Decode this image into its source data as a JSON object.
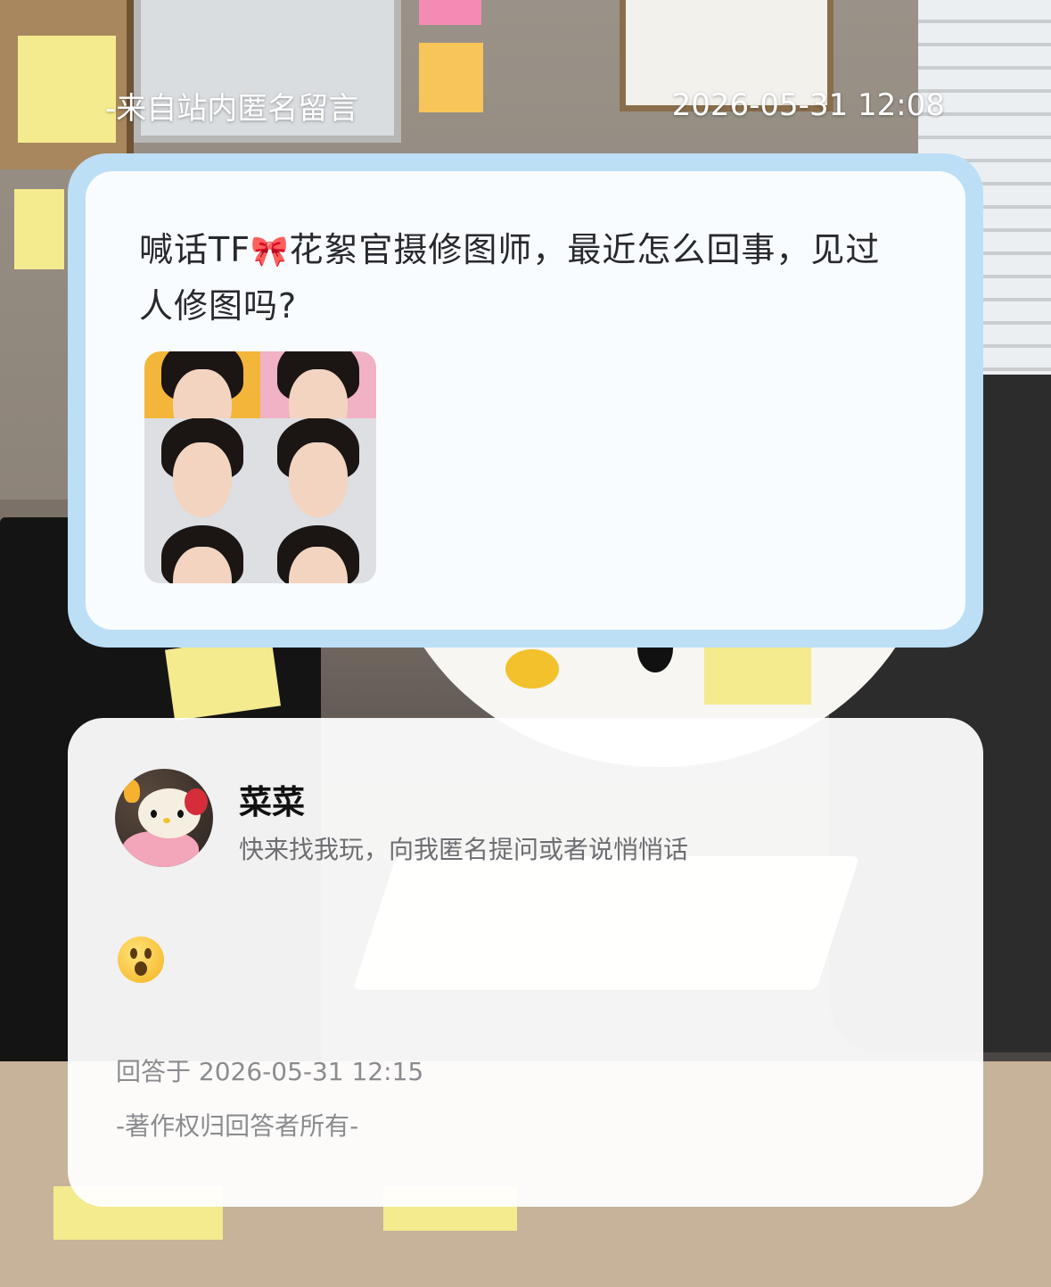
{
  "header": {
    "source_label": "-来自站内匿名留言",
    "timestamp": "2026-05-31 12:08"
  },
  "question": {
    "text_before": "喊话TF",
    "emoji": "🎀",
    "text_after": "花絮官摄修图师，最近怎么回事，见过人修图吗?",
    "image_grid_icon": "photo-collage-image"
  },
  "answer": {
    "user_name": "菜菜",
    "user_bio": "快来找我玩，向我匿名提问或者说悄悄话",
    "reply_emoji_icon": "astonished-face-emoji",
    "answered_at": "回答于 2026-05-31 12:15",
    "copyright": "-著作权归回答者所有-"
  },
  "colors": {
    "card_border": "#bcdff6",
    "header_text": "#ffffff",
    "question_text": "#27292e",
    "muted_text": "#8b8c90"
  }
}
